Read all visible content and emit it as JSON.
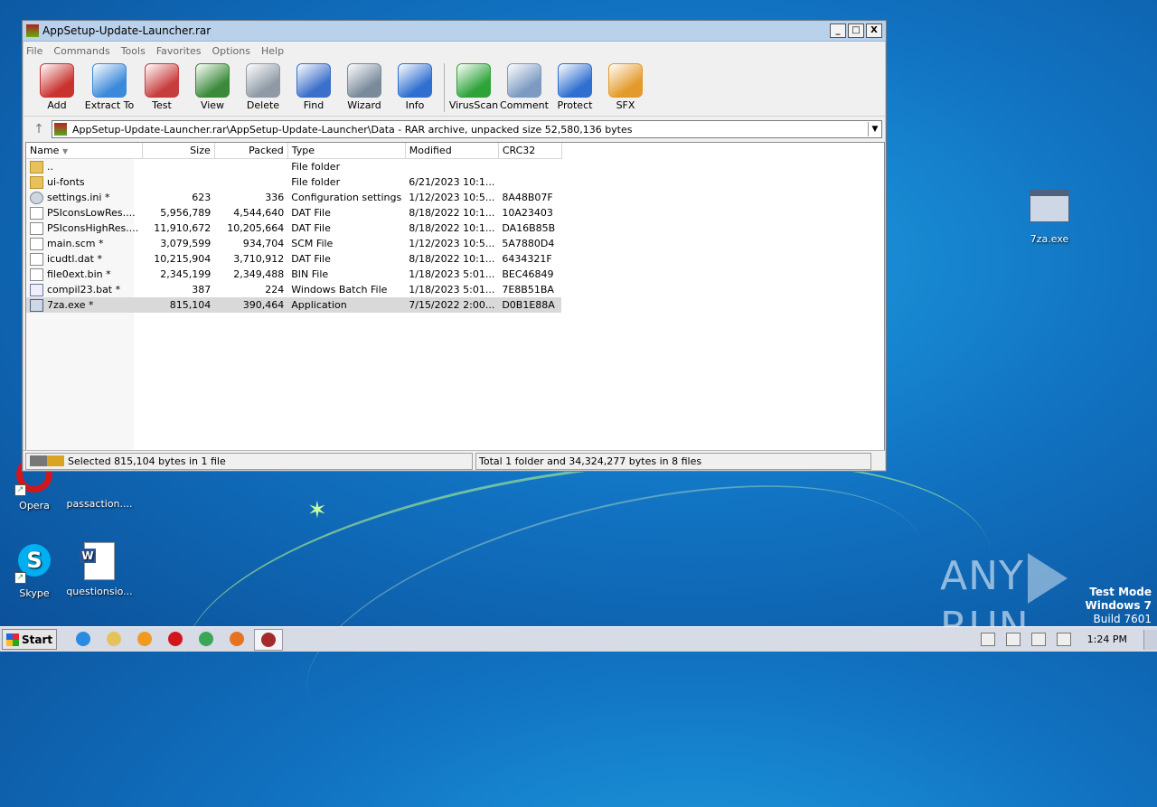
{
  "window": {
    "title": "AppSetup-Update-Launcher.rar",
    "minimize": "_",
    "maximize": "□",
    "close": "X"
  },
  "menu": [
    "File",
    "Commands",
    "Tools",
    "Favorites",
    "Options",
    "Help"
  ],
  "toolbar": [
    {
      "label": "Add",
      "icon": "add-icon",
      "color": "#c8322f"
    },
    {
      "label": "Extract To",
      "icon": "extract-icon",
      "color": "#3b8ad9"
    },
    {
      "label": "Test",
      "icon": "test-icon",
      "color": "#c73c3c"
    },
    {
      "label": "View",
      "icon": "view-book-icon",
      "color": "#3a8a3a"
    },
    {
      "label": "Delete",
      "icon": "trash-icon",
      "color": "#8f9aa6"
    },
    {
      "label": "Find",
      "icon": "magnifier-icon",
      "color": "#3b6fc9"
    },
    {
      "label": "Wizard",
      "icon": "wand-icon",
      "color": "#7a8a9a"
    },
    {
      "label": "Info",
      "icon": "info-icon",
      "color": "#2f6fd0"
    },
    {
      "label": "VirusScan",
      "icon": "bug-icon",
      "color": "#2ea33a"
    },
    {
      "label": "Comment",
      "icon": "comment-icon",
      "color": "#7c9ac2"
    },
    {
      "label": "Protect",
      "icon": "shield-icon",
      "color": "#2f6fd0"
    },
    {
      "label": "SFX",
      "icon": "sfx-box-icon",
      "color": "#e39a2a"
    }
  ],
  "address": {
    "up": "↑",
    "path": "AppSetup-Update-Launcher.rar\\AppSetup-Update-Launcher\\Data - RAR archive, unpacked size 52,580,136 bytes",
    "dropdown": "▼"
  },
  "columns": [
    "Name",
    "Size",
    "Packed",
    "Type",
    "Modified",
    "CRC32"
  ],
  "sort_indicator": "▼",
  "files": [
    {
      "name": "..",
      "size": "",
      "packed": "",
      "type": "File folder",
      "modified": "",
      "crc": "",
      "kind": "folder"
    },
    {
      "name": "ui-fonts",
      "size": "",
      "packed": "",
      "type": "File folder",
      "modified": "6/21/2023 10:1...",
      "crc": "",
      "kind": "folder"
    },
    {
      "name": "settings.ini *",
      "size": "623",
      "packed": "336",
      "type": "Configuration settings",
      "modified": "1/12/2023 10:5...",
      "crc": "8A48B07F",
      "kind": "gear"
    },
    {
      "name": "PSIconsLowRes....",
      "size": "5,956,789",
      "packed": "4,544,640",
      "type": "DAT File",
      "modified": "8/18/2022 10:1...",
      "crc": "10A23403",
      "kind": "file"
    },
    {
      "name": "PSIconsHighRes....",
      "size": "11,910,672",
      "packed": "10,205,664",
      "type": "DAT File",
      "modified": "8/18/2022 10:1...",
      "crc": "DA16B85B",
      "kind": "file"
    },
    {
      "name": "main.scm *",
      "size": "3,079,599",
      "packed": "934,704",
      "type": "SCM File",
      "modified": "1/12/2023 10:5...",
      "crc": "5A7880D4",
      "kind": "file"
    },
    {
      "name": "icudtl.dat *",
      "size": "10,215,904",
      "packed": "3,710,912",
      "type": "DAT File",
      "modified": "8/18/2022 10:1...",
      "crc": "6434321F",
      "kind": "file"
    },
    {
      "name": "file0ext.bin *",
      "size": "2,345,199",
      "packed": "2,349,488",
      "type": "BIN File",
      "modified": "1/18/2023 5:01...",
      "crc": "BEC46849",
      "kind": "file"
    },
    {
      "name": "compil23.bat *",
      "size": "387",
      "packed": "224",
      "type": "Windows Batch File",
      "modified": "1/18/2023 5:01...",
      "crc": "7E8B51BA",
      "kind": "bat"
    },
    {
      "name": "7za.exe *",
      "size": "815,104",
      "packed": "390,464",
      "type": "Application",
      "modified": "7/15/2022 2:00...",
      "crc": "D0B1E88A",
      "kind": "app",
      "selected": true
    }
  ],
  "status": {
    "left": "Selected 815,104 bytes in 1 file",
    "right": "Total 1 folder and 34,324,277 bytes in 8 files"
  },
  "desktop": {
    "icons": [
      {
        "label": "Opera",
        "icon": "opera-icon",
        "color": "#d2161e"
      },
      {
        "label": "passaction....",
        "icon": "blank-file-icon",
        "color": "#1d7ad0"
      },
      {
        "label": "Skype",
        "icon": "skype-icon",
        "color": "#00aff0"
      },
      {
        "label": "questionsio...",
        "icon": "word-doc-icon",
        "color": "#2b5797"
      },
      {
        "label": "7za.exe",
        "icon": "exe-icon",
        "color": "#cdd7e5"
      }
    ],
    "watermark": "ANY RUN",
    "testmode": [
      "Test Mode",
      "Windows 7",
      "Build 7601"
    ]
  },
  "taskbar": {
    "start": "Start",
    "apps": [
      {
        "icon": "ie-icon",
        "color": "#2b8be0"
      },
      {
        "icon": "explorer-icon",
        "color": "#e6c35a"
      },
      {
        "icon": "media-player-icon",
        "color": "#f09a1e"
      },
      {
        "icon": "opera-icon",
        "color": "#d2161e"
      },
      {
        "icon": "chrome-icon",
        "color": "#3aa757"
      },
      {
        "icon": "firefox-icon",
        "color": "#e8731e"
      },
      {
        "icon": "winrar-icon",
        "color": "#a32b2b",
        "active": true
      }
    ],
    "clock": "1:24 PM"
  }
}
